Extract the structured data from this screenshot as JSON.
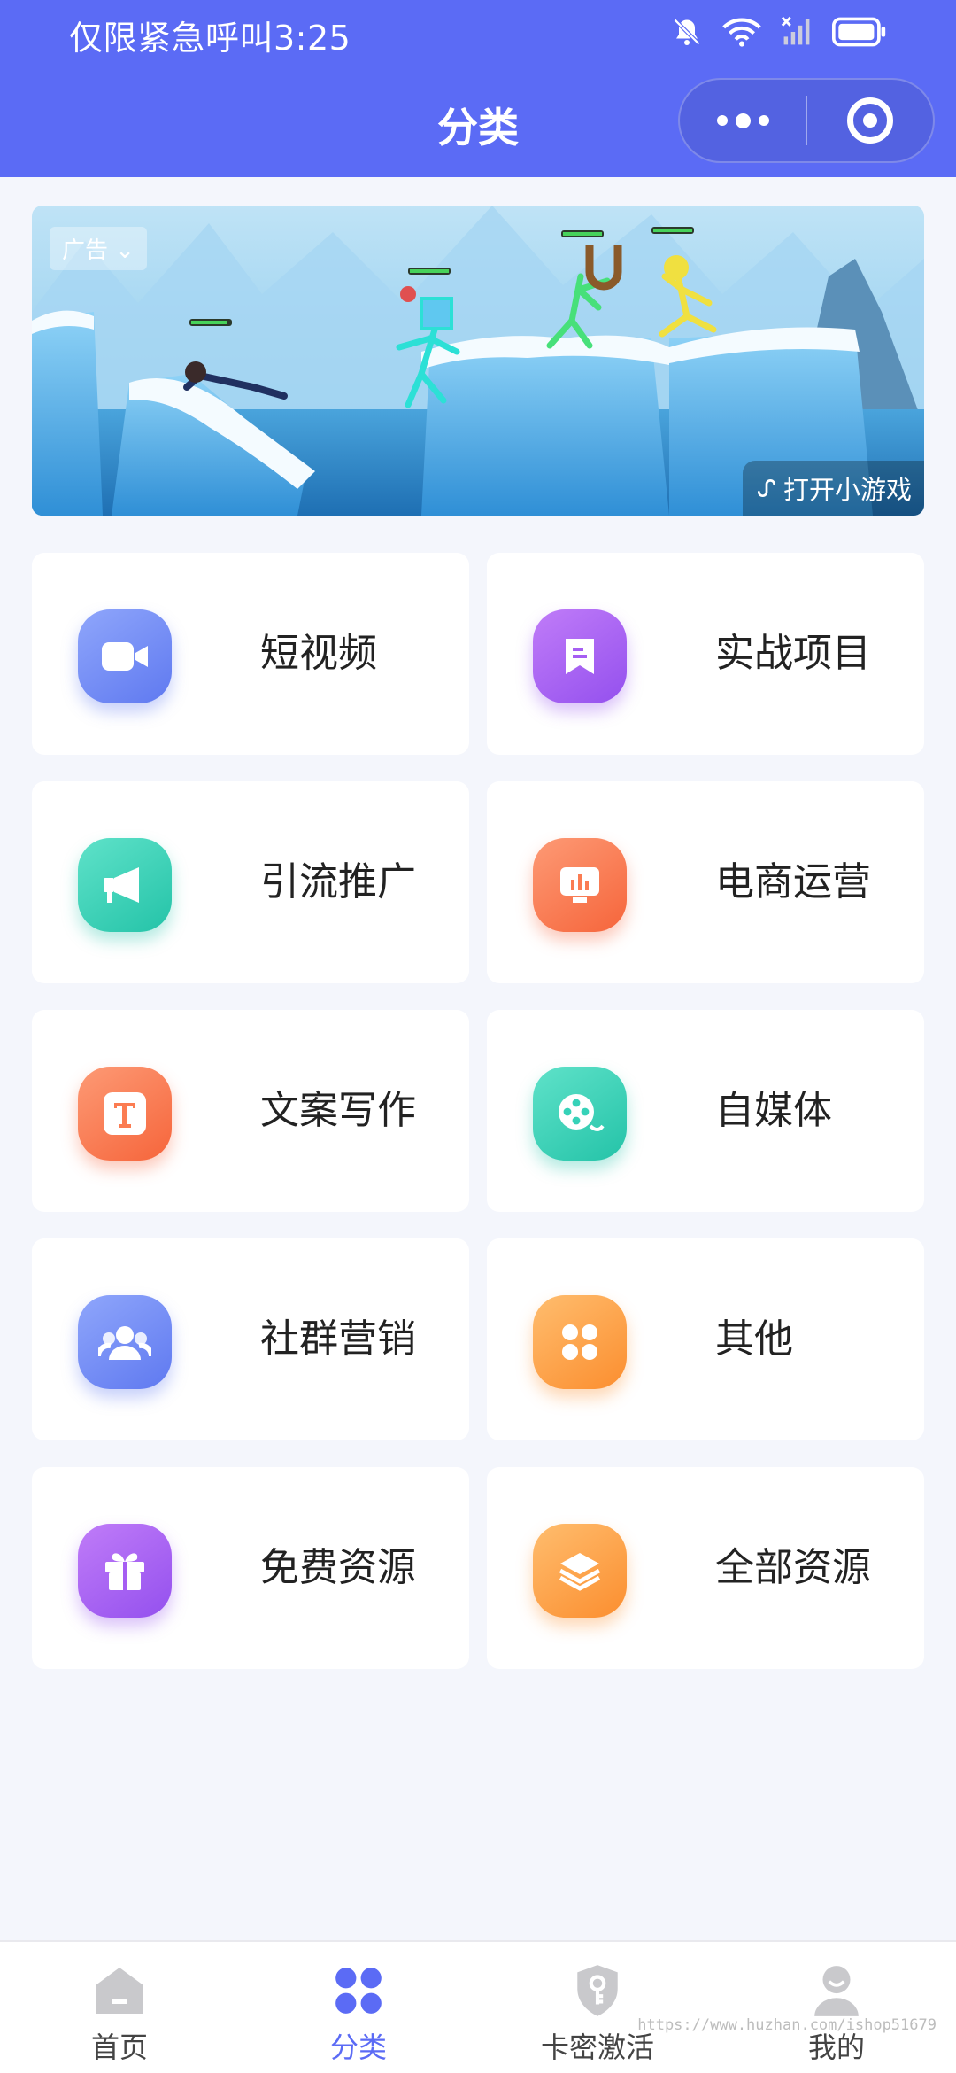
{
  "status_bar": {
    "text": "仅限紧急呼叫3:25",
    "icons": [
      "mute-bell-icon",
      "wifi-icon",
      "no-signal-icon",
      "battery-icon"
    ]
  },
  "nav": {
    "title": "分类",
    "capsule": {
      "more_icon": "more-dots-icon",
      "close_icon": "target-close-icon"
    }
  },
  "banner": {
    "ad_label": "广告",
    "open_label": "打开小游戏"
  },
  "categories": [
    {
      "label": "短视频",
      "icon": "video-camera-icon",
      "color": "#6f8bf6"
    },
    {
      "label": "实战项目",
      "icon": "bookmark-icon",
      "color": "#a65ef2"
    },
    {
      "label": "引流推广",
      "icon": "megaphone-icon",
      "color": "#36d2b8"
    },
    {
      "label": "电商运营",
      "icon": "chart-board-icon",
      "color": "#fb7c52"
    },
    {
      "label": "文案写作",
      "icon": "text-t-icon",
      "color": "#fb7c52"
    },
    {
      "label": "自媒体",
      "icon": "film-reel-icon",
      "color": "#36d2b8"
    },
    {
      "label": "社群营销",
      "icon": "group-icon",
      "color": "#6f8bf6"
    },
    {
      "label": "其他",
      "icon": "four-petal-icon",
      "color": "#fca045"
    },
    {
      "label": "免费资源",
      "icon": "gift-icon",
      "color": "#a65ef2"
    },
    {
      "label": "全部资源",
      "icon": "layers-icon",
      "color": "#fca045"
    }
  ],
  "tabs": [
    {
      "label": "首页",
      "icon": "home-icon"
    },
    {
      "label": "分类",
      "icon": "category-icon",
      "active": true
    },
    {
      "label": "卡密激活",
      "icon": "shield-key-icon"
    },
    {
      "label": "我的",
      "icon": "user-icon"
    }
  ],
  "watermark": "https://www.huzhan.com/ishop51679",
  "colors": {
    "accent": "#5b6bf5",
    "background": "#f4f6fc"
  }
}
